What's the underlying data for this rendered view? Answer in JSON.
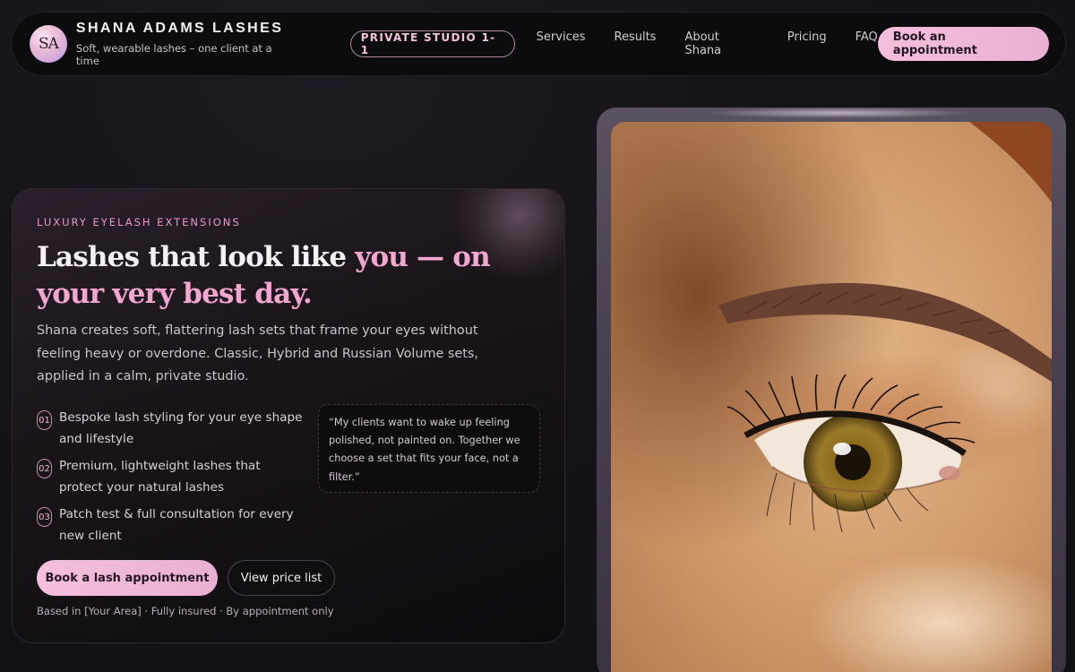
{
  "nav": {
    "logo_initials": "SA",
    "brand_name": "SHANA ADAMS LASHES",
    "brand_tagline": "Soft, wearable lashes – one client at a time",
    "badge": "PRIVATE STUDIO 1-1",
    "links": [
      "Services",
      "Results",
      "About Shana",
      "Pricing",
      "FAQ"
    ],
    "cta": "Book an appointment"
  },
  "hero": {
    "eyebrow": "LUXURY EYELASH EXTENSIONS",
    "headline_plain": "Lashes that look like ",
    "headline_accent": "you — on your very best day.",
    "lede": "Shana creates soft, flattering lash sets that frame your eyes without feeling heavy or overdone. Classic, Hybrid and Russian Volume sets, applied in a calm, private studio.",
    "features": [
      {
        "num": "01",
        "text": "Bespoke lash styling for your eye shape and lifestyle"
      },
      {
        "num": "02",
        "text": "Premium, lightweight lashes that protect your natural lashes"
      },
      {
        "num": "03",
        "text": "Patch test & full consultation for every new client"
      }
    ],
    "quote": "“My clients want to wake up feeling polished, not painted on. Together we choose a set that fits your face, not a filter.”",
    "primary_cta": "Book a lash appointment",
    "secondary_cta": "View price list",
    "footnote": "Based in [Your Area] · Fully insured · By appointment only"
  },
  "colors": {
    "accent_pink": "#f3a6cf",
    "button_pink": "#f5bfdc",
    "background": "#141317"
  }
}
